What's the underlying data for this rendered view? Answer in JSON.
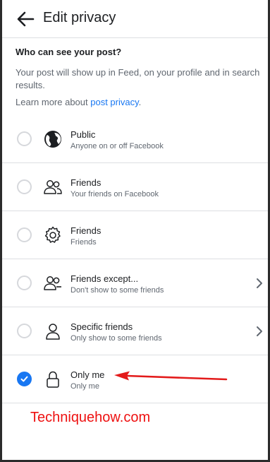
{
  "header": {
    "title": "Edit privacy",
    "back_icon": "arrow-left-icon"
  },
  "intro": {
    "heading": "Who can see your post?",
    "description": "Your post will show up in Feed, on your profile and in search results.",
    "learn_prefix": "Learn more about ",
    "learn_link": "post privacy",
    "learn_suffix": "."
  },
  "options": [
    {
      "label": "Public",
      "sublabel": "Anyone on or off Facebook",
      "icon": "globe-icon",
      "selected": false,
      "has_chevron": false
    },
    {
      "label": "Friends",
      "sublabel": "Your friends on Facebook",
      "icon": "friends-icon",
      "selected": false,
      "has_chevron": false
    },
    {
      "label": "Friends",
      "sublabel": "Friends",
      "icon": "gear-icon",
      "selected": false,
      "has_chevron": false
    },
    {
      "label": "Friends except...",
      "sublabel": "Don't show to some friends",
      "icon": "friends-except-icon",
      "selected": false,
      "has_chevron": true
    },
    {
      "label": "Specific friends",
      "sublabel": "Only show to some friends",
      "icon": "person-icon",
      "selected": false,
      "has_chevron": true
    },
    {
      "label": "Only me",
      "sublabel": "Only me",
      "icon": "lock-icon",
      "selected": true,
      "has_chevron": false
    }
  ],
  "watermark": "Techniquehow.com",
  "colors": {
    "accent": "#1877f2",
    "annotation": "#ee1111"
  }
}
